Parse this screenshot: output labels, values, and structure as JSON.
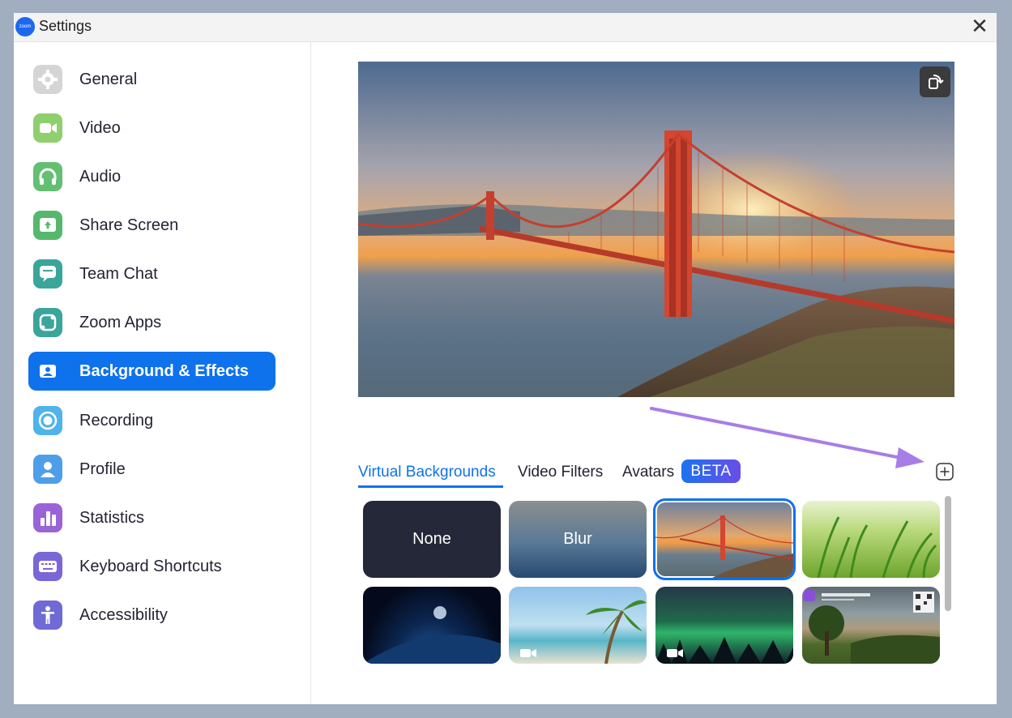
{
  "window": {
    "title": "Settings",
    "logo_text": "zoom",
    "close_glyph": "✕"
  },
  "sidebar": {
    "items": [
      {
        "label": "General",
        "icon": "gear-icon",
        "color": "#d5d5d5"
      },
      {
        "label": "Video",
        "icon": "video-camera-icon",
        "color": "#8fcf6e"
      },
      {
        "label": "Audio",
        "icon": "headphones-icon",
        "color": "#63c072"
      },
      {
        "label": "Share Screen",
        "icon": "share-screen-icon",
        "color": "#55b86c"
      },
      {
        "label": "Team Chat",
        "icon": "chat-icon",
        "color": "#3aa59a"
      },
      {
        "label": "Zoom Apps",
        "icon": "apps-icon",
        "color": "#3aa59a"
      },
      {
        "label": "Background & Effects",
        "icon": "background-icon",
        "color": "#0e72ed",
        "active": true
      },
      {
        "label": "Recording",
        "icon": "record-icon",
        "color": "#4fb3ec"
      },
      {
        "label": "Profile",
        "icon": "profile-icon",
        "color": "#4f9fe8"
      },
      {
        "label": "Statistics",
        "icon": "statistics-icon",
        "color": "#9a63d6"
      },
      {
        "label": "Keyboard Shortcuts",
        "icon": "keyboard-icon",
        "color": "#7b66d8"
      },
      {
        "label": "Accessibility",
        "icon": "accessibility-icon",
        "color": "#6e6ad6"
      }
    ]
  },
  "preview": {
    "image": "golden-gate-bridge-sunset",
    "rotate_icon": "rotate-icon"
  },
  "tabs": {
    "items": [
      {
        "label": "Virtual Backgrounds",
        "active": true
      },
      {
        "label": "Video Filters"
      },
      {
        "label": "Avatars"
      }
    ],
    "beta_label": "BETA",
    "add_icon": "plus-icon"
  },
  "backgrounds": {
    "items": [
      {
        "label": "None"
      },
      {
        "label": "Blur"
      },
      {
        "label": "",
        "image": "golden-gate-bridge",
        "selected": true
      },
      {
        "label": "",
        "image": "green-grass"
      },
      {
        "label": "",
        "image": "earth-from-space"
      },
      {
        "label": "",
        "image": "palm-beach",
        "video": true
      },
      {
        "label": "",
        "image": "aurora",
        "video": true
      },
      {
        "label": "",
        "image": "park-poster",
        "badge": "H"
      }
    ]
  }
}
